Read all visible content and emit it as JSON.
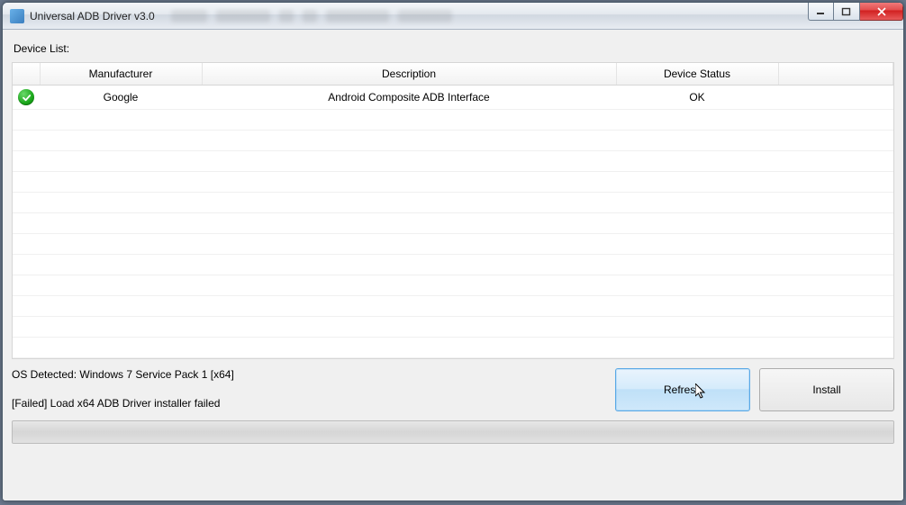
{
  "window": {
    "title": "Universal ADB Driver v3.0"
  },
  "section_label": "Device List:",
  "table": {
    "headers": {
      "manufacturer": "Manufacturer",
      "description": "Description",
      "device_status": "Device Status"
    },
    "rows": [
      {
        "status_icon": "ok",
        "manufacturer": "Google",
        "description": "Android Composite ADB Interface",
        "device_status": "OK"
      }
    ]
  },
  "os_detected": "OS Detected: Windows 7 Service Pack 1 [x64]",
  "status_message": "[Failed] Load x64 ADB Driver installer failed",
  "buttons": {
    "refresh": "Refresh",
    "install": "Install"
  }
}
